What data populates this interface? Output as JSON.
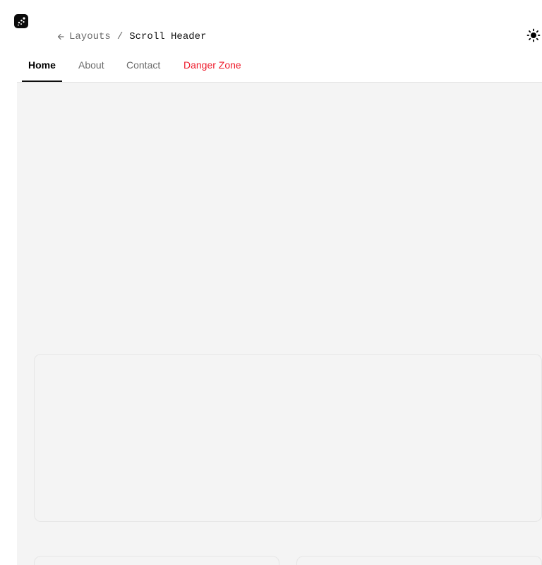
{
  "app": {
    "logo_icon": "sparkle-dots-logo",
    "theme_icon": "sun-icon"
  },
  "breadcrumb": {
    "back_icon": "arrow-left-icon",
    "parent": "Layouts",
    "separator": "/",
    "current": "Scroll Header"
  },
  "tabs": [
    {
      "label": "Home",
      "active": true
    },
    {
      "label": "About",
      "active": false
    },
    {
      "label": "Contact",
      "active": false
    },
    {
      "label": "Danger Zone",
      "active": false,
      "color": "#ee1c2c"
    }
  ],
  "colors": {
    "content_background": "#f4f4f4",
    "danger": "#ee1c2c",
    "active_tab": "#000000",
    "inactive_tab": "#6b6b6b"
  }
}
